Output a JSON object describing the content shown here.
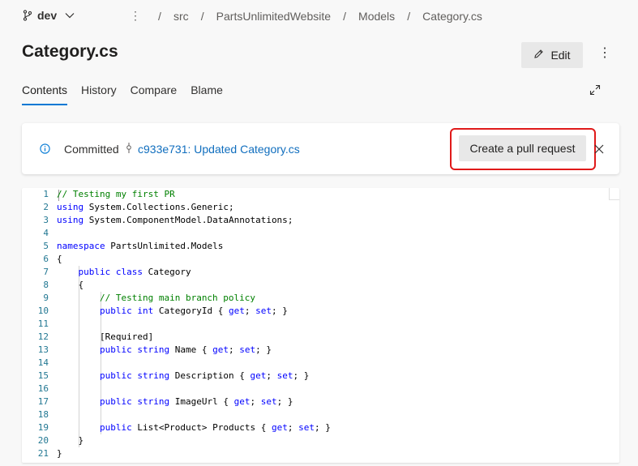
{
  "branch": {
    "name": "dev"
  },
  "breadcrumb": [
    "src",
    "PartsUnlimitedWebsite",
    "Models",
    "Category.cs"
  ],
  "breadcrumb_separator": "/",
  "file": {
    "title": "Category.cs"
  },
  "toolbar": {
    "edit_label": "Edit"
  },
  "tabs": [
    {
      "label": "Contents",
      "active": true
    },
    {
      "label": "History",
      "active": false
    },
    {
      "label": "Compare",
      "active": false
    },
    {
      "label": "Blame",
      "active": false
    }
  ],
  "commit_bar": {
    "committed_label": "Committed",
    "commit_link": "c933e731: Updated Category.cs",
    "pr_button_label": "Create a pull request"
  },
  "colors": {
    "accent": "#0078d4",
    "link": "#106ebe",
    "highlight": "#e01a1a"
  },
  "icons": [
    "branch-icon",
    "chevron-down-icon",
    "more-vertical-icon",
    "pencil-icon",
    "expand-icon",
    "info-icon",
    "commit-icon",
    "close-icon"
  ],
  "code": {
    "lines": [
      {
        "n": "1",
        "text": "// Testing my first PR"
      },
      {
        "n": "2",
        "text": "using System.Collections.Generic;"
      },
      {
        "n": "3",
        "text": "using System.ComponentModel.DataAnnotations;"
      },
      {
        "n": "4",
        "text": ""
      },
      {
        "n": "5",
        "text": "namespace PartsUnlimited.Models"
      },
      {
        "n": "6",
        "text": "{"
      },
      {
        "n": "7",
        "text": "    public class Category"
      },
      {
        "n": "8",
        "text": "    {"
      },
      {
        "n": "9",
        "text": "        // Testing main branch policy"
      },
      {
        "n": "10",
        "text": "        public int CategoryId { get; set; }"
      },
      {
        "n": "11",
        "text": ""
      },
      {
        "n": "12",
        "text": "        [Required]"
      },
      {
        "n": "13",
        "text": "        public string Name { get; set; }"
      },
      {
        "n": "14",
        "text": ""
      },
      {
        "n": "15",
        "text": "        public string Description { get; set; }"
      },
      {
        "n": "16",
        "text": ""
      },
      {
        "n": "17",
        "text": "        public string ImageUrl { get; set; }"
      },
      {
        "n": "18",
        "text": ""
      },
      {
        "n": "19",
        "text": "        public List<Product> Products { get; set; }"
      },
      {
        "n": "20",
        "text": "    }"
      },
      {
        "n": "21",
        "text": "}"
      }
    ]
  }
}
